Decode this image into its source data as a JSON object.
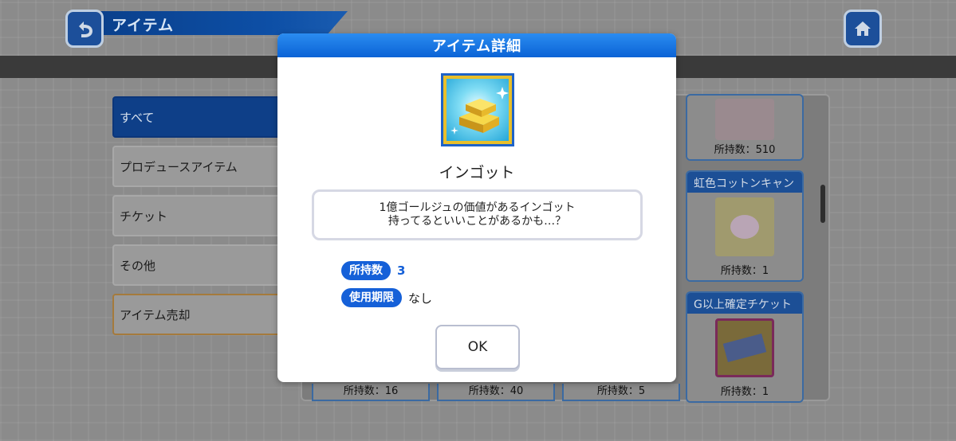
{
  "header": {
    "title": "アイテム"
  },
  "sidebar": {
    "items": [
      {
        "label": "すべて"
      },
      {
        "label": "プロデュースアイテム"
      },
      {
        "label": "チケット"
      },
      {
        "label": "その他"
      },
      {
        "label": "アイテム売却"
      }
    ]
  },
  "grid": {
    "cards": [
      {
        "name": "",
        "count": "所持数：510"
      },
      {
        "name": "虹色コットンキャン",
        "count": "所持数：1"
      },
      {
        "name": "G以上確定チケット",
        "count": "所持数：1"
      }
    ],
    "bottom_counts": [
      "所持数：16",
      "所持数：40",
      "所持数：5"
    ]
  },
  "modal": {
    "title": "アイテム詳細",
    "item_name": "インゴット",
    "description_line1": "1億ゴールジュの価値があるインゴット",
    "description_line2": "持ってるといいことがあるかも…？",
    "owned_label": "所持数",
    "owned_value": "3",
    "expiry_label": "使用期限",
    "expiry_value": "なし",
    "ok_label": "OK"
  },
  "icons": {
    "back": "back-arrow-icon",
    "home": "home-icon",
    "item": "gold-ingot-icon"
  },
  "colors": {
    "accent_blue": "#1560d8",
    "header_gradient_top": "#2b8cf0",
    "icon_frame_gold": "#e9bf2a"
  }
}
